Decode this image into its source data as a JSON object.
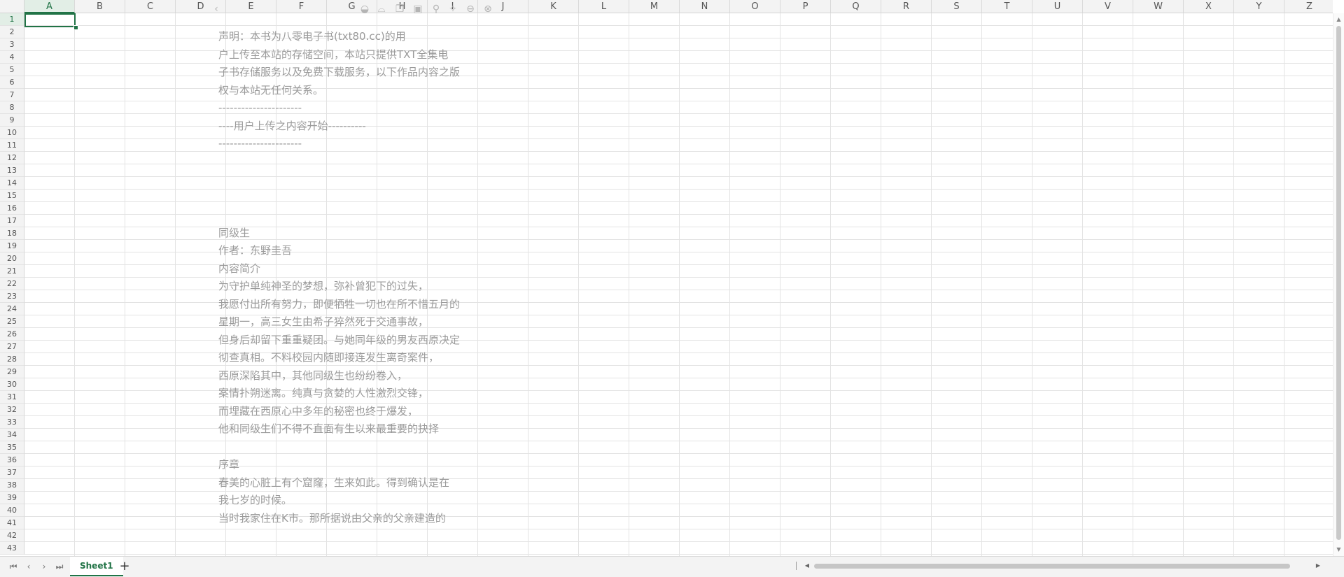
{
  "grid": {
    "columns": [
      "A",
      "B",
      "C",
      "D",
      "E",
      "F",
      "G",
      "H",
      "I",
      "J",
      "K",
      "L",
      "M",
      "N",
      "O",
      "P",
      "Q",
      "R",
      "S",
      "T",
      "U",
      "V",
      "W",
      "X",
      "Y",
      "Z"
    ],
    "rows": [
      "1",
      "2",
      "3",
      "4",
      "5",
      "6",
      "7",
      "8",
      "9",
      "10",
      "11",
      "12",
      "13",
      "14",
      "15",
      "16",
      "17",
      "18",
      "19",
      "20",
      "21",
      "22",
      "23",
      "24",
      "25",
      "26",
      "27",
      "28",
      "29",
      "30",
      "31",
      "32",
      "33",
      "34",
      "35",
      "36",
      "37",
      "38",
      "39",
      "40",
      "41",
      "42",
      "43"
    ],
    "active_column": "A",
    "active_row": "1",
    "accent_color": "#217346"
  },
  "text_box": {
    "lines": [
      "声明：本书为八零电子书(txt80.cc)的用",
      "户上传至本站的存储空间，本站只提供TXT全集电",
      "子书存储服务以及免费下载服务，以下作品内容之版",
      "权与本站无任何关系。",
      "----------------------",
      "----用户上传之内容开始----------",
      "----------------------",
      "",
      "",
      "",
      "",
      "同级生",
      "作者：东野圭吾",
      "内容简介",
      "为守护单纯神圣的梦想，弥补曾犯下的过失，",
      "我愿付出所有努力，即便牺牲一切也在所不惜五月的",
      "星期一，高三女生由希子猝然死于交通事故，",
      "但身后却留下重重疑团。与她同年级的男友西原决定",
      "彻查真相。不料校园内随即接连发生离奇案件，",
      "西原深陷其中，其他同级生也纷纷卷入，",
      "案情扑朔迷离。纯真与贪婪的人性激烈交锋，",
      "而埋藏在西原心中多年的秘密也终于爆发，",
      "他和同级生们不得不直面有生以来最重要的抉择",
      "",
      "序章",
      "春美的心脏上有个窟窿，生来如此。得到确认是在",
      "我七岁的时候。",
      "当时我家住在K市。那所据说由父亲的父亲建造的"
    ]
  },
  "float_toolbar": {
    "icons": [
      "chevron-left-icon",
      "half-circle-icon",
      "crop-icon",
      "copy-icon",
      "image-icon",
      "pin-icon",
      "sparkle-icon",
      "minus-circle-icon",
      "close-circle-icon"
    ],
    "glyphs": [
      "‹",
      "◒",
      "⌓",
      "❐",
      "▣",
      "⚲",
      "✧",
      "⊖",
      "⊗"
    ]
  },
  "sheets": {
    "tabs": [
      "Sheet1"
    ],
    "active": "Sheet1",
    "add_label": "+"
  },
  "nav": {
    "first": "⏮",
    "prev": "‹",
    "next": "›",
    "last": "⏭"
  }
}
